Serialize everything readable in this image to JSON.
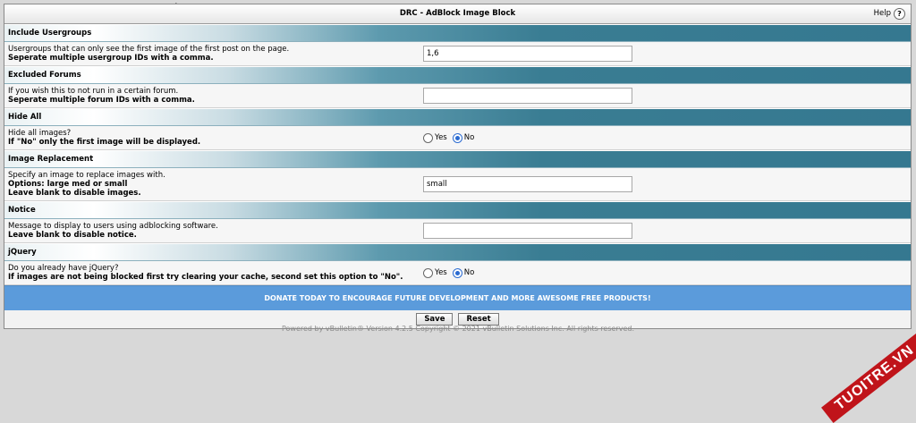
{
  "title": "DRC - AdBlock Image Block",
  "help_label": "Help",
  "sections": [
    {
      "heading": "Include Usergroups",
      "desc": "Usergroups that can only see the first image of the first post on the page.",
      "bold": [
        "Seperate multiple usergroup IDs with a comma."
      ],
      "value": "1,6"
    },
    {
      "heading": "Excluded Forums",
      "desc": "If you wish this to not run in a certain forum.",
      "bold": [
        "Seperate multiple forum IDs with a comma."
      ],
      "value": ""
    },
    {
      "heading": "Hide All",
      "desc": "Hide all images?",
      "bold": [
        "If \"No\" only the first image will be displayed."
      ],
      "yes_label": "Yes",
      "no_label": "No",
      "selected": "No"
    },
    {
      "heading": "Image Replacement",
      "desc": "Specify an image to replace images with.",
      "bold": [
        "Options: large med or small",
        "Leave blank to disable images."
      ],
      "value": "small"
    },
    {
      "heading": "Notice",
      "desc": "Message to display to users using adblocking software.",
      "bold": [
        "Leave blank to disable notice."
      ],
      "value": ""
    },
    {
      "heading": "jQuery",
      "desc": "Do you already have jQuery?",
      "bold": [
        "If images are not being blocked first try clearing your cache, second set this option to \"No\"."
      ],
      "yes_label": "Yes",
      "no_label": "No",
      "selected": "No"
    }
  ],
  "donate_text": "DONATE TODAY TO ENCOURAGE FUTURE DEVELOPMENT AND MORE AWESOME FREE PRODUCTS!",
  "save_label": "Save",
  "reset_label": "Reset",
  "footer": "Powered by vBulletin® Version 4.2.5 Copyright © 2021 vBulletin Solutions Inc. All rights reserved.",
  "watermark": "TUOITRE.VN"
}
